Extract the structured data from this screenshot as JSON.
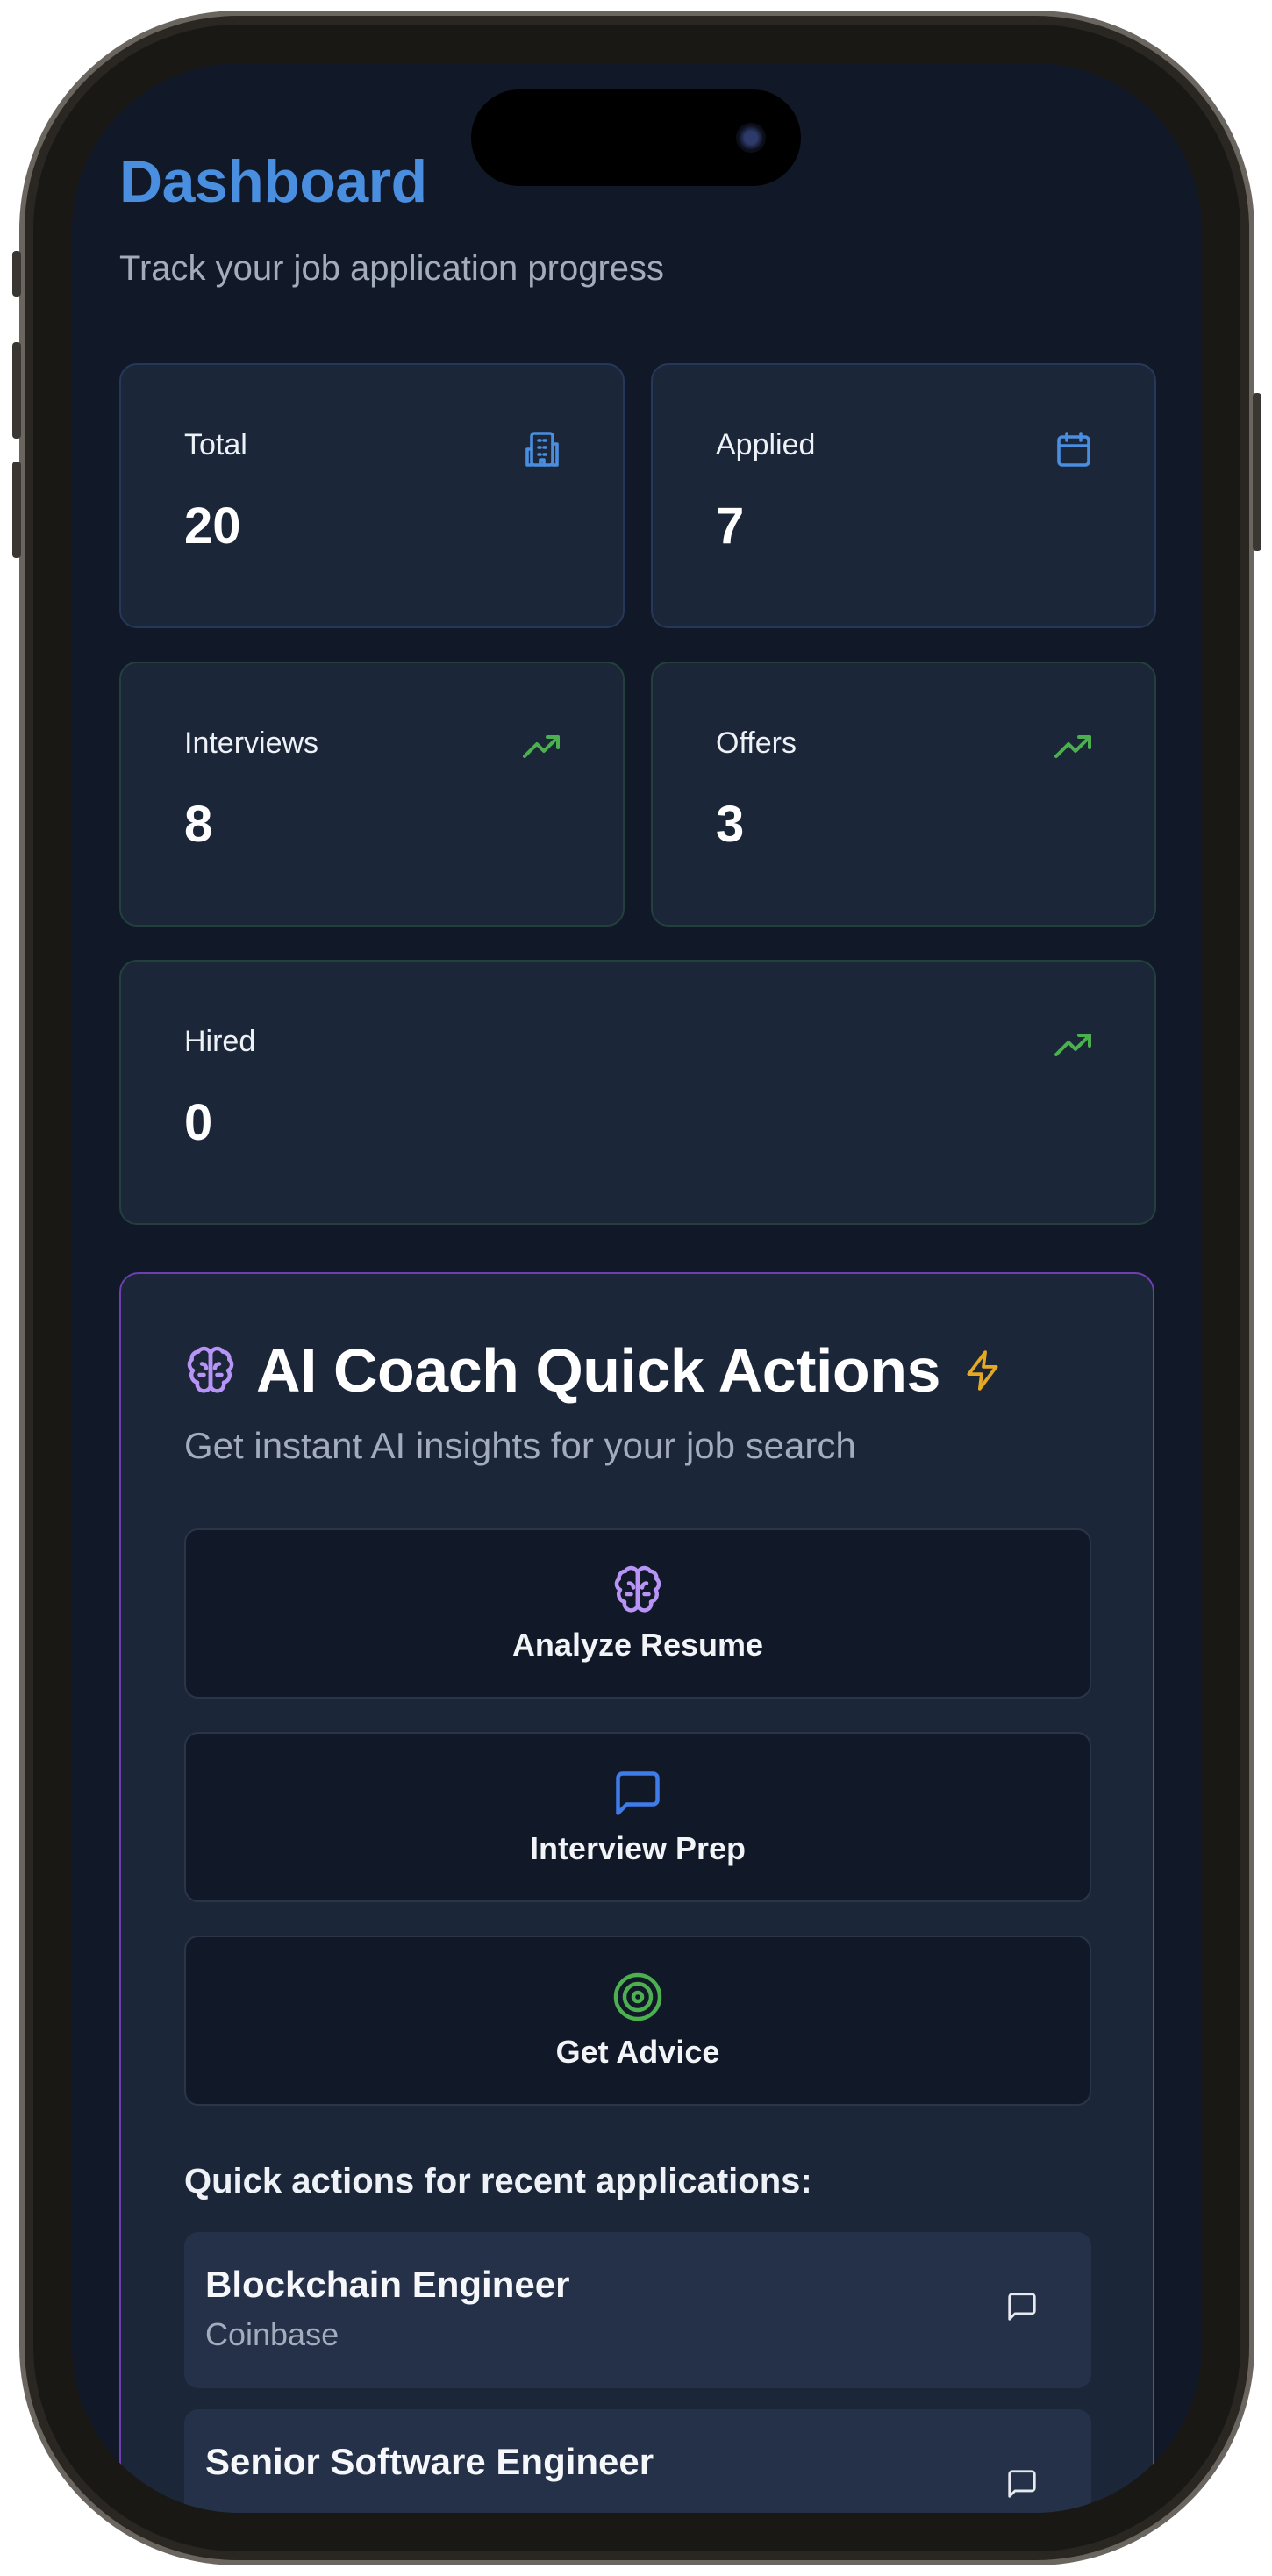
{
  "header": {
    "title": "Dashboard",
    "subtitle": "Track your job application progress"
  },
  "stats": [
    {
      "label": "Total",
      "value": "20",
      "icon": "building-icon"
    },
    {
      "label": "Applied",
      "value": "7",
      "icon": "calendar-icon"
    },
    {
      "label": "Interviews",
      "value": "8",
      "icon": "trending-up-icon"
    },
    {
      "label": "Offers",
      "value": "3",
      "icon": "trending-up-icon"
    },
    {
      "label": "Hired",
      "value": "0",
      "icon": "trending-up-icon"
    }
  ],
  "ai_coach": {
    "title": "AI Coach Quick Actions",
    "subtitle": "Get instant AI insights for your job search",
    "actions": [
      {
        "label": "Analyze Resume",
        "icon": "brain-icon"
      },
      {
        "label": "Interview Prep",
        "icon": "message-square-icon"
      },
      {
        "label": "Get Advice",
        "icon": "target-icon"
      }
    ],
    "recent_heading": "Quick actions for recent applications:",
    "recent": [
      {
        "title": "Blockchain Engineer",
        "company": "Coinbase"
      },
      {
        "title": "Senior Software Engineer",
        "company": ""
      }
    ]
  },
  "colors": {
    "background": "#111827",
    "card": "#1b2639",
    "accent_blue": "#4a8ee0",
    "accent_green": "#4caf50",
    "accent_purple": "#b794f6",
    "accent_yellow": "#e5a823"
  }
}
